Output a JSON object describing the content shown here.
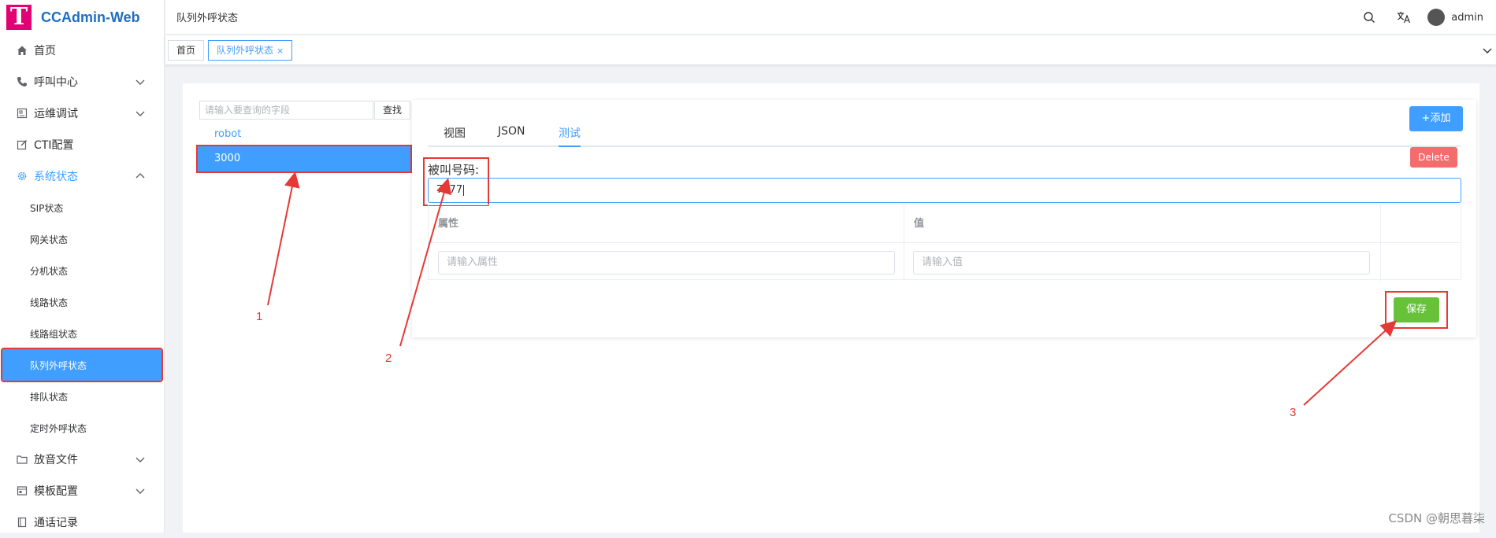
{
  "app": {
    "logo_letter": "T",
    "name": "CCAdmin-Web",
    "brand_color": "#e20074",
    "accent_color": "#409eff"
  },
  "sidebar": {
    "home": "首页",
    "call_center": "呼叫中心",
    "ops_debug": "运维调试",
    "cti_config": "CTI配置",
    "system_status": "系统状态",
    "sub_items": [
      "SIP状态",
      "网关状态",
      "分机状态",
      "线路状态",
      "线路组状态",
      "队列外呼状态",
      "排队状态",
      "定时外呼状态"
    ],
    "audio_files": "放音文件",
    "template_config": "模板配置",
    "call_records": "通话记录"
  },
  "header": {
    "breadcrumb": "队列外呼状态",
    "username": "admin"
  },
  "tags": {
    "home": "首页",
    "current": "队列外呼状态",
    "close": "×"
  },
  "left_list": {
    "search_placeholder": "请输入要查询的字段",
    "search_button": "查找",
    "items": [
      "robot",
      "3000"
    ]
  },
  "detail": {
    "tabs": [
      "视图",
      "JSON",
      "测试"
    ],
    "called_number_label": "被叫号码:",
    "called_number_value": "7777",
    "table_headers": [
      "属性",
      "值"
    ],
    "add_button": "+添加",
    "attr_placeholder": "请输入属性",
    "value_placeholder": "请输入值",
    "delete_button": "Delete",
    "save_button": "保存"
  },
  "annotations": [
    "1",
    "2",
    "3"
  ],
  "watermark": "CSDN @朝思暮柒"
}
